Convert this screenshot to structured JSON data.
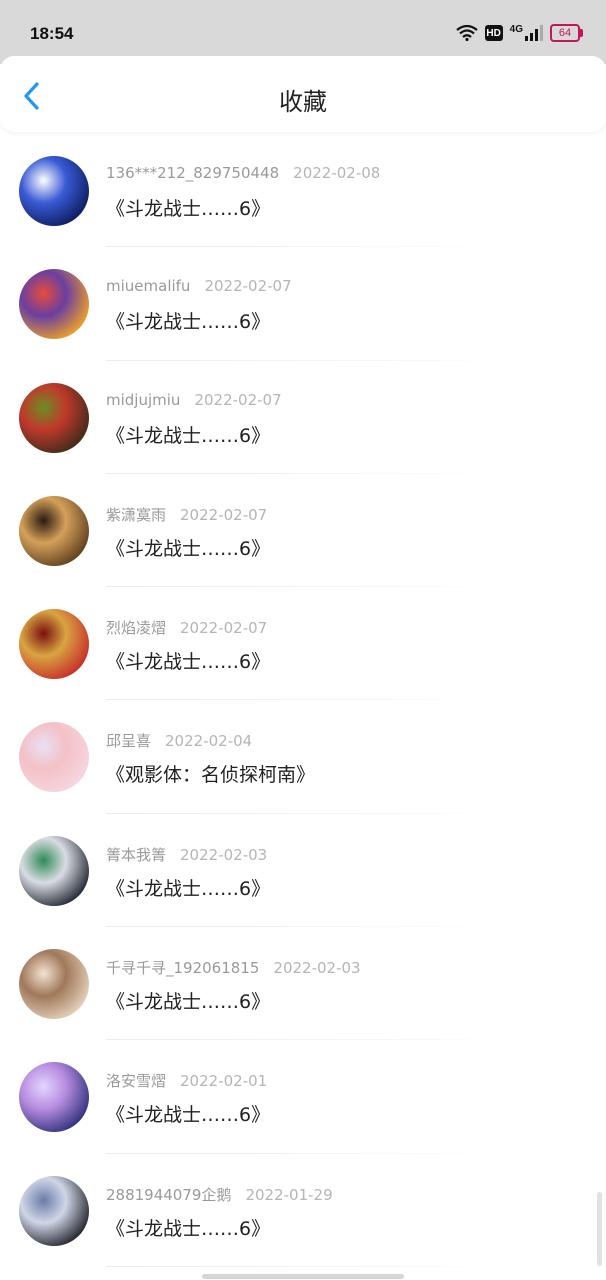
{
  "status": {
    "time": "18:54",
    "hd": "HD",
    "network": "4G",
    "battery": "64"
  },
  "header": {
    "title": "收藏",
    "back_icon": "chevron-left-icon",
    "accent_color": "#2196f3"
  },
  "items": [
    {
      "user": "136***212_829750448",
      "date": "2022-02-08",
      "book": "《斗龙战士……6》",
      "avatar_colors": [
        "#0b1a5a",
        "#3a5bd6",
        "#ffffff"
      ]
    },
    {
      "user": "miuemalifu",
      "date": "2022-02-07",
      "book": "《斗龙战士……6》",
      "avatar_colors": [
        "#f5a623",
        "#6a3fa0",
        "#e84c3d"
      ]
    },
    {
      "user": "midjujmiu",
      "date": "2022-02-07",
      "book": "《斗龙战士……6》",
      "avatar_colors": [
        "#3b2a1a",
        "#c0392b",
        "#6b8e23"
      ]
    },
    {
      "user": "紫潇寞雨",
      "date": "2022-02-07",
      "book": "《斗龙战士……6》",
      "avatar_colors": [
        "#5a3b1c",
        "#d4a15a",
        "#2b1a0e"
      ]
    },
    {
      "user": "烈焰凌熠",
      "date": "2022-02-07",
      "book": "《斗龙战士……6》",
      "avatar_colors": [
        "#c62828",
        "#d9a441",
        "#7a1010"
      ]
    },
    {
      "user": "邱呈喜",
      "date": "2022-02-04",
      "book": "《观影体：名侦探柯南》",
      "avatar_colors": [
        "#f8d7e0",
        "#f3c1c6",
        "#e9e0f5"
      ]
    },
    {
      "user": "箐本我箐",
      "date": "2022-02-03",
      "book": "《斗龙战士……6》",
      "avatar_colors": [
        "#1a1f2b",
        "#d9dce3",
        "#2e8b57"
      ]
    },
    {
      "user": "千寻千寻_192061815",
      "date": "2022-02-03",
      "book": "《斗龙战士……6》",
      "avatar_colors": [
        "#e9d5c0",
        "#a0785a",
        "#f3e3d2"
      ]
    },
    {
      "user": "洛安雪熠",
      "date": "2022-02-01",
      "book": "《斗龙战士……6》",
      "avatar_colors": [
        "#2a2f7a",
        "#b88de0",
        "#e4d5ff"
      ]
    },
    {
      "user": "2881944079企鹅",
      "date": "2022-01-29",
      "book": "《斗龙战士……6》",
      "avatar_colors": [
        "#1c1c24",
        "#cfd6e6",
        "#6b7ba8"
      ]
    }
  ]
}
